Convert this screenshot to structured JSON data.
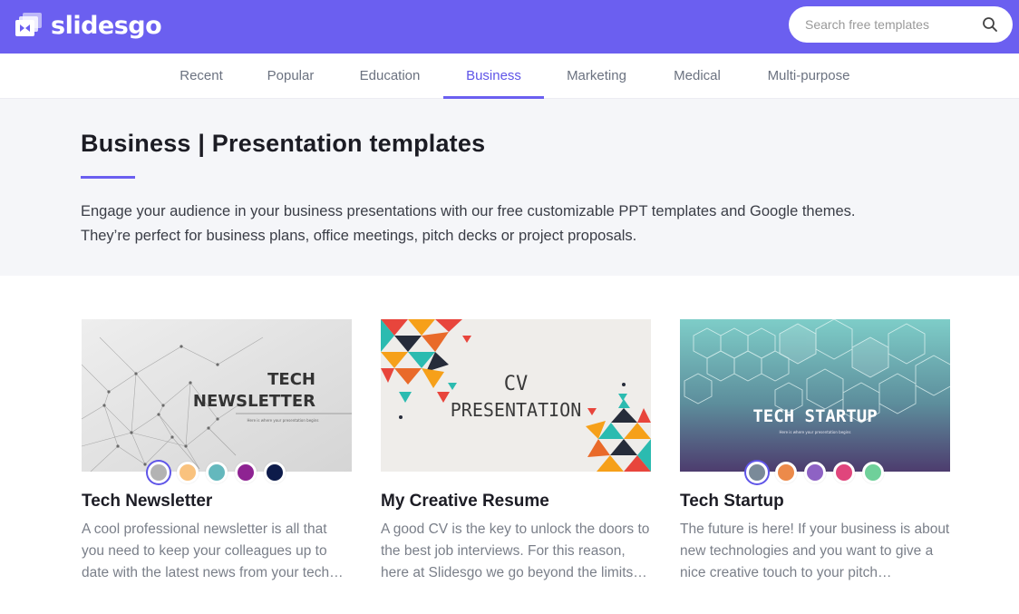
{
  "brand": {
    "name": "slidesgo"
  },
  "search": {
    "placeholder": "Search free templates"
  },
  "nav": {
    "tabs": [
      {
        "label": "Recent"
      },
      {
        "label": "Popular"
      },
      {
        "label": "Education"
      },
      {
        "label": "Business",
        "active": true
      },
      {
        "label": "Marketing"
      },
      {
        "label": "Medical"
      },
      {
        "label": "Multi-purpose"
      }
    ]
  },
  "intro": {
    "title": "Business | Presentation templates",
    "description_line1": "Engage your audience in your business presentations with our free customizable PPT templates and Google themes.",
    "description_line2": "They’re perfect for business plans, office meetings, pitch decks or project proposals."
  },
  "cards": [
    {
      "title": "Tech Newsletter",
      "description": "A cool professional newsletter is all that you need to keep your colleagues up to date with the latest news from your tech…",
      "thumb_title_line1": "TECH",
      "thumb_title_line2": "NEWSLETTER",
      "thumb_subtitle": "Here is where your presentation begins",
      "swatches": [
        "#b3b3b3",
        "#f9c27e",
        "#64b8bd",
        "#8e2392",
        "#0d1b4a"
      ]
    },
    {
      "title": "My Creative Resume",
      "description": "A good CV is the key to unlock the doors to the best job interviews. For this reason, here at Slidesgo we go beyond the limits…",
      "thumb_title_line1": "CV",
      "thumb_title_line2": "PRESENTATION",
      "swatches": []
    },
    {
      "title": "Tech Startup",
      "description": "The future is here! If your business is about new technologies and you want to give a nice creative touch to your pitch…",
      "thumb_title_line1": "TECH STARTUP",
      "thumb_subtitle": "Here is where your presentation begins",
      "swatches": [
        "#7a8a99",
        "#ec8a4a",
        "#8e62c4",
        "#e0457c",
        "#6fd09a"
      ]
    }
  ],
  "colors": {
    "brand": "#6b5ff0",
    "active_tab": "#5f55e8"
  }
}
